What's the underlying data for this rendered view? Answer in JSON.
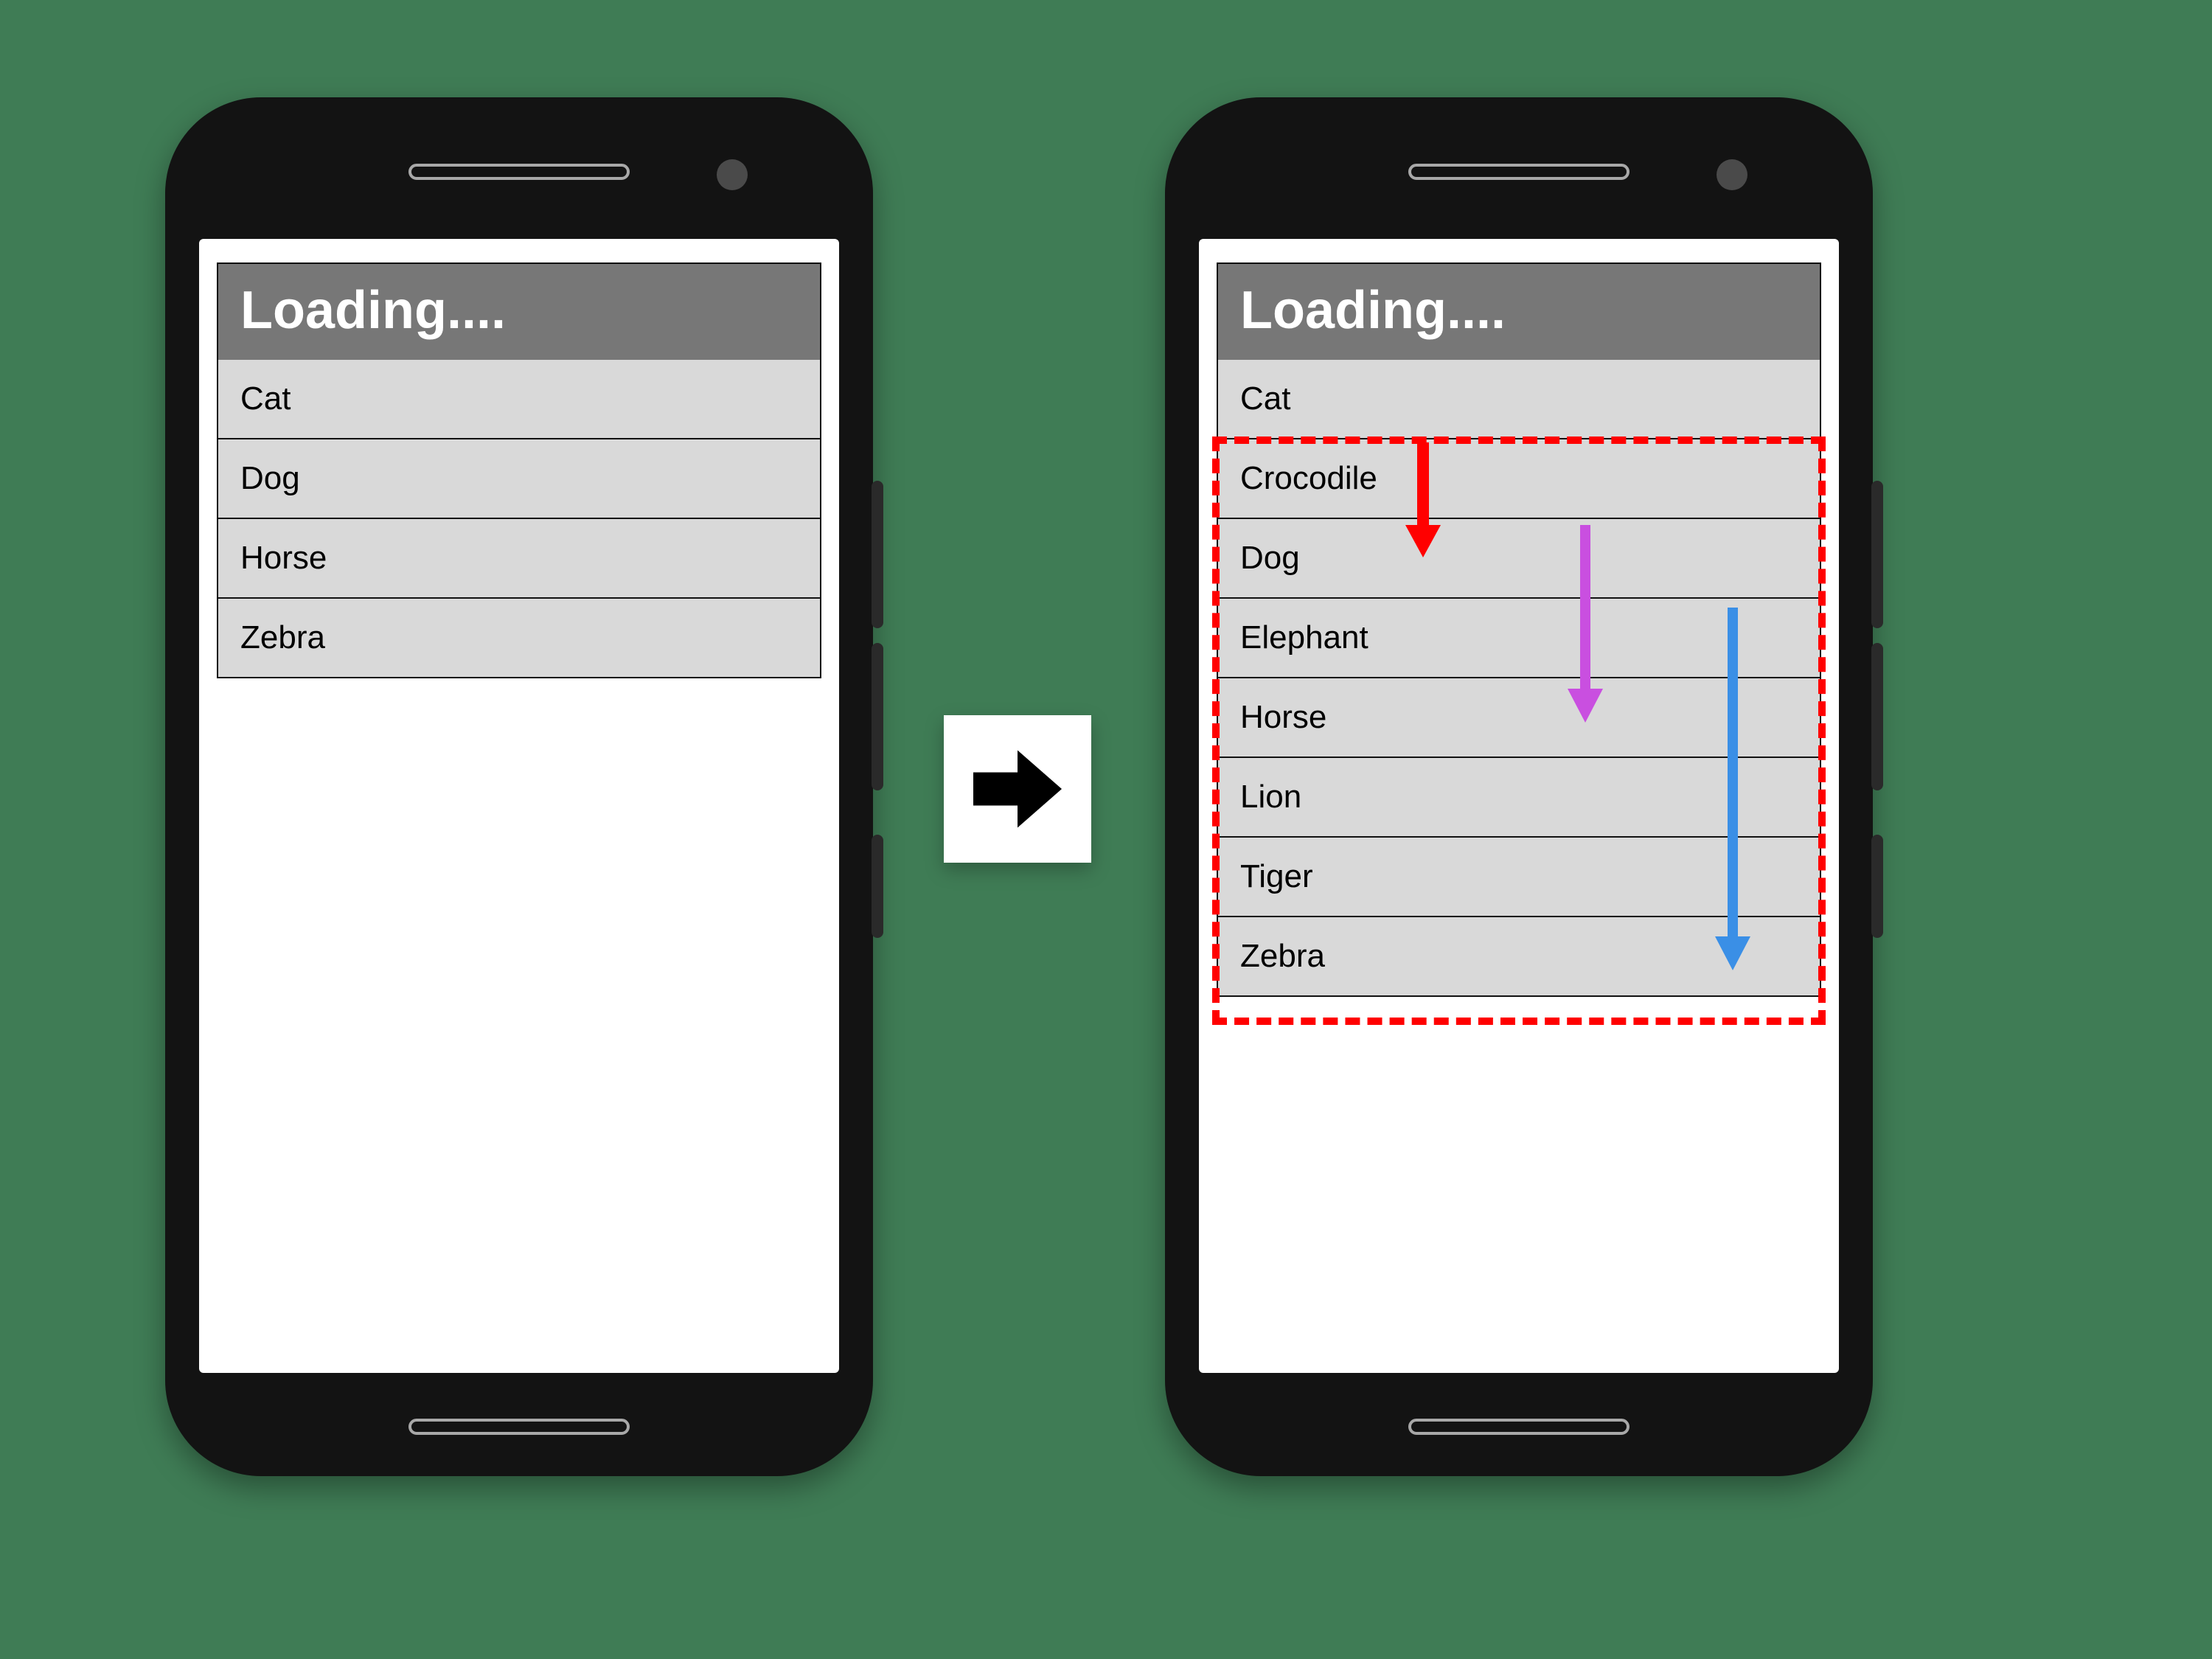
{
  "phone_left": {
    "title": "Loading....",
    "rows": [
      "Cat",
      "Dog",
      "Horse",
      "Zebra"
    ]
  },
  "phone_right": {
    "title": "Loading....",
    "rows": [
      "Cat",
      "Crocodile",
      "Dog",
      "Elephant",
      "Horse",
      "Lion",
      "Tiger",
      "Zebra"
    ]
  },
  "highlight": {
    "start_row_index": 1,
    "end_row_index": 7,
    "color": "#ff0000"
  },
  "arrows": {
    "red": {
      "color": "#ff0000",
      "from_row": 1,
      "to_row": 2
    },
    "purple": {
      "color": "#c94fe0",
      "from_row": 2,
      "to_row": 4
    },
    "blue": {
      "color": "#3a8fe6",
      "from_row": 3,
      "to_row": 7
    }
  }
}
